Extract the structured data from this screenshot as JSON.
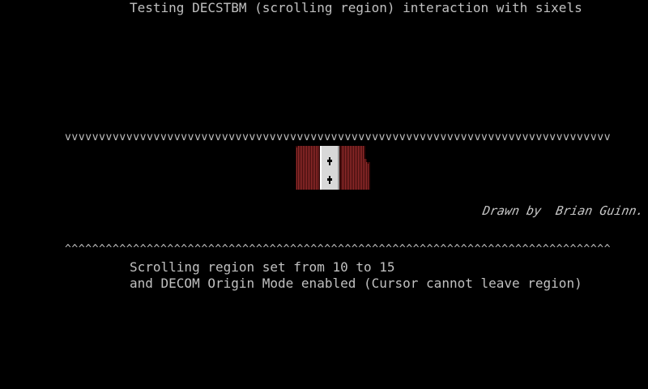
{
  "terminal": {
    "title": "Testing DECSTBM (scrolling region) interaction with sixels",
    "top_border": "vvvvvvvvvvvvvvvvvvvvvvvvvvvvvvvvvvvvvvvvvvvvvvvvvvvvvvvvvvvvvvvvvvvvvvvvvvvvvvvv",
    "bottom_border": "^^^^^^^^^^^^^^^^^^^^^^^^^^^^^^^^^^^^^^^^^^^^^^^^^^^^^^^^^^^^^^^^^^^^^^^^^^^^^^^^",
    "credit": "Drawn by  Brian Guinn.",
    "description_line1": "Scrolling region set from 10 to 15",
    "description_line2": "and DECOM Origin Mode enabled (Cursor cannot leave region)"
  },
  "colors": {
    "background": "#000000",
    "text": "#c0c0c0",
    "curtain_red": "#8b2a2a",
    "curtain_dark": "#3a0a0a",
    "panel_light": "#d8d8d8"
  }
}
